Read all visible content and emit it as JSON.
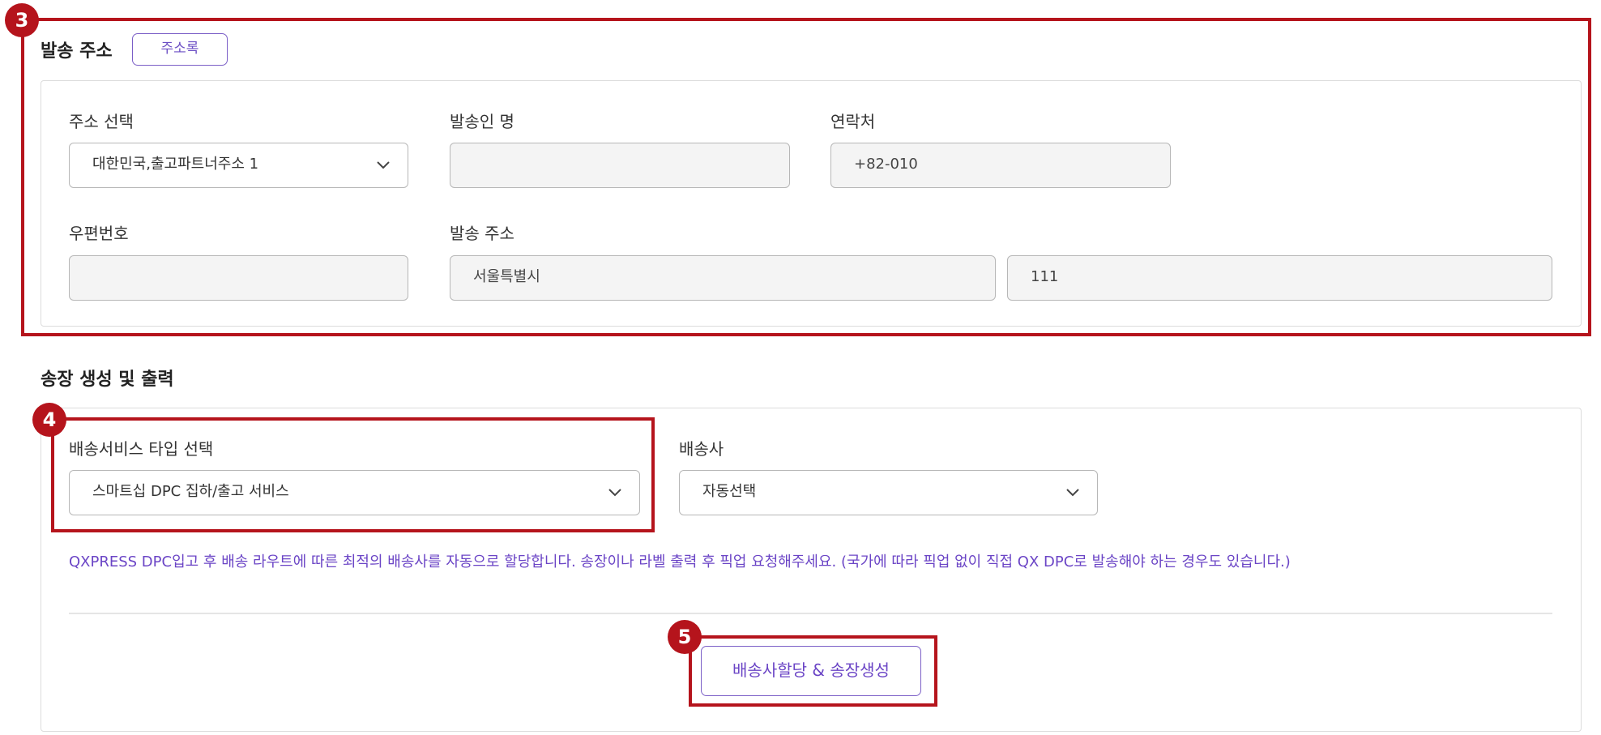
{
  "sender_section": {
    "title": "발송 주소",
    "address_book_button": "주소록",
    "fields": {
      "address_select": {
        "label": "주소 선택",
        "value": "대한민국,출고파트너주소 1"
      },
      "sender_name": {
        "label": "발송인 명",
        "value": ""
      },
      "contact": {
        "label": "연락처",
        "value": "+82-010"
      },
      "postal_code": {
        "label": "우편번호",
        "value": ""
      },
      "address": {
        "label": "발송 주소",
        "value_1": "서울특별시",
        "value_2": "111"
      }
    }
  },
  "invoice_section": {
    "title": "송장 생성 및 출력",
    "service_type": {
      "label": "배송서비스 타입 선택",
      "value": "스마트십 DPC 집하/출고 서비스"
    },
    "carrier": {
      "label": "배송사",
      "value": "자동선택"
    },
    "notice": "QXPRESS DPC입고 후 배송 라우트에 따른 최적의 배송사를 자동으로 할당합니다. 송장이나 라벨 출력 후 픽업 요청해주세요. (국가에 따라 픽업 없이 직접 QX DPC로 발송해야 하는 경우도 있습니다.)",
    "generate_button": "배송사할당 & 송장생성"
  },
  "annotations": {
    "badge_3": "3",
    "badge_4": "4",
    "badge_5": "5"
  },
  "colors": {
    "accent": "#6b45c6",
    "annotation_red": "#b5141c",
    "field_bg": "#f4f4f4"
  }
}
